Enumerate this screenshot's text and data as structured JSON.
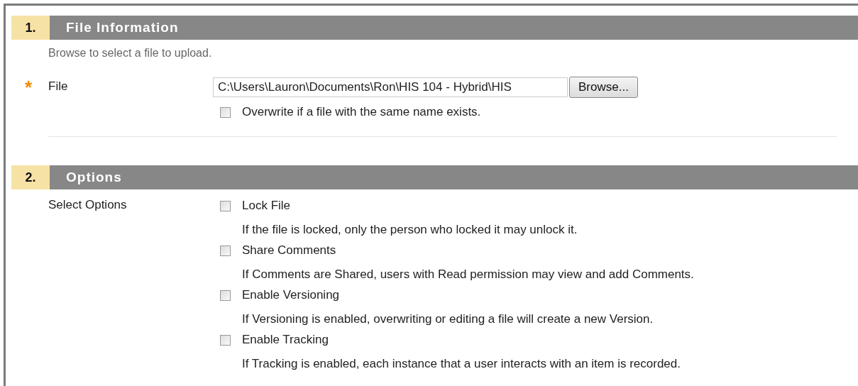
{
  "sections": [
    {
      "number": "1.",
      "title": "File Information",
      "instructions": "Browse to select a file to upload.",
      "file_field": {
        "label": "File",
        "required_mark": "*",
        "value": "C:\\Users\\Lauron\\Documents\\Ron\\HIS 104 - Hybrid\\HIS",
        "button": "Browse...",
        "overwrite": {
          "label": "Overwrite if a file with the same name exists.",
          "checked": false
        }
      }
    },
    {
      "number": "2.",
      "title": "Options",
      "options_label": "Select Options",
      "options": [
        {
          "label": "Lock File",
          "checked": false,
          "description": "If the file is locked, only the person who locked it may unlock it."
        },
        {
          "label": "Share Comments",
          "checked": false,
          "description": "If Comments are Shared, users with Read permission may view and add Comments."
        },
        {
          "label": "Enable Versioning",
          "checked": false,
          "description": "If Versioning is enabled, overwriting or editing a file will create a new Version."
        },
        {
          "label": "Enable Tracking",
          "checked": false,
          "description": "If Tracking is enabled, each instance that a user interacts with an item is recorded."
        }
      ]
    }
  ]
}
